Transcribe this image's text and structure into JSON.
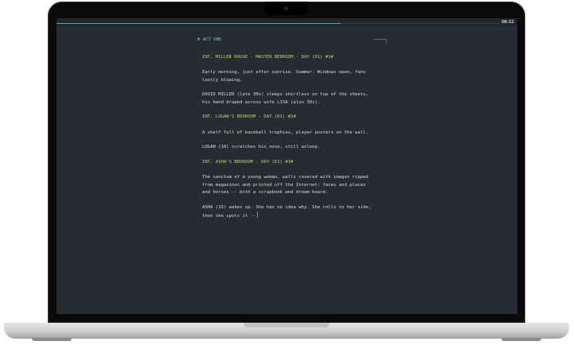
{
  "status": {
    "clock": "08:22",
    "progress_fraction": 0.64
  },
  "document": {
    "act": "# ACT ONE",
    "scenes": [
      {
        "heading": "INT. MILLER HOUSE - MASTER BEDROOM - DAY (D1) #1#",
        "paragraphs": [
          "Early morning, just after sunrise. Summer. Windows open, fans\nlazily blowing.",
          "DAVID MILLER (late 30s) sleeps shirtless on top of the sheets,\nhis hand draped across wife LISA (also 30s)."
        ]
      },
      {
        "heading": "INT. LOGAN'S BEDROOM - DAY (D1) #2#",
        "paragraphs": [
          "A shelf full of baseball trophies, player posters on the wall.",
          "LOGAN (10) scratches his nose, still asleep."
        ]
      },
      {
        "heading": "INT. ASHA'S BEDROOM - DAY (D1) #3#",
        "paragraphs": [
          "The sanctum of a young woman, walls covered with images ripped\nfrom magazines and printed off the Internet: faces and places\nand horses -- both a scrapbook and dream board.",
          "ASHA (15) wakes up. She has no idea why. She rolls to her side,\nthen she spots it --"
        ]
      }
    ]
  },
  "colors": {
    "background": "#252c33",
    "heading": "#b5d46a",
    "act": "#7cc7a2",
    "text": "#d7dde1",
    "cursor": "#e0556a",
    "progress": "#4fa7b8"
  }
}
